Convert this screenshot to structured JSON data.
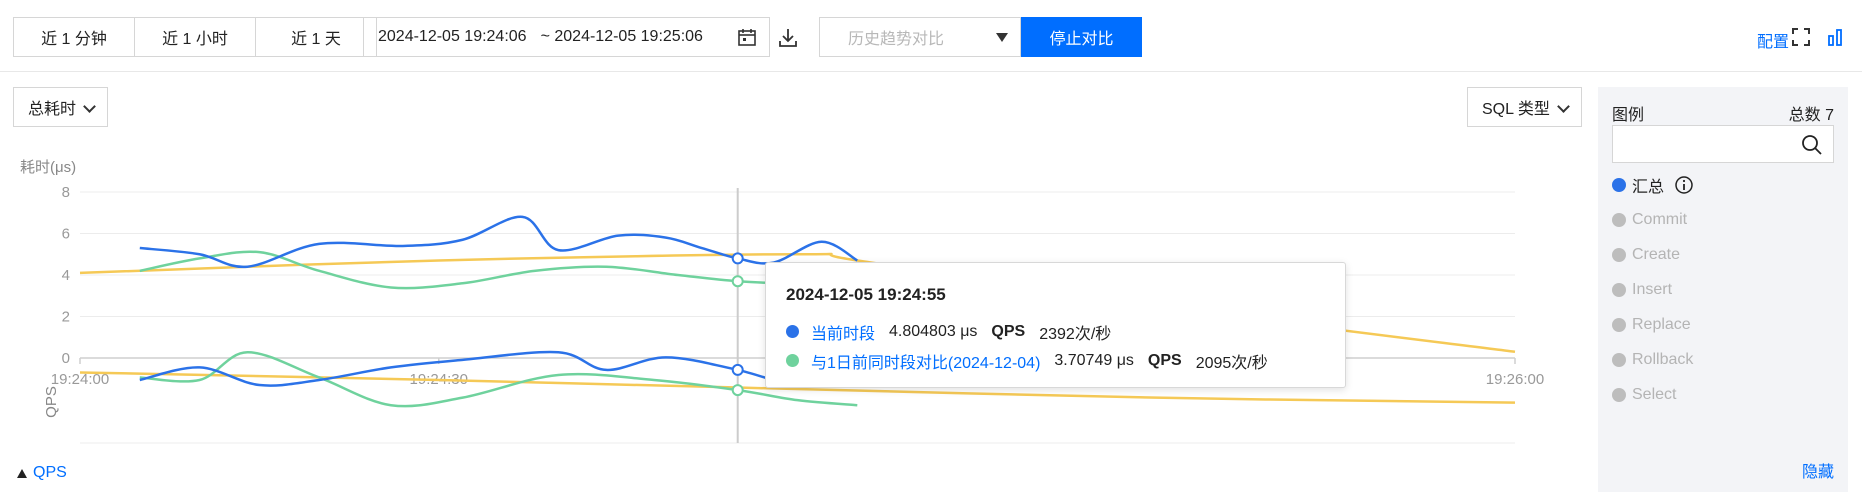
{
  "toolbar": {
    "ranges": [
      "近 1 分钟",
      "近 1 小时",
      "近 1 天"
    ],
    "date_start": "2024-12-05 19:24:06",
    "date_end": "~ 2024-12-05 19:25:06",
    "history_placeholder": "历史趋势对比",
    "stop_compare": "停止对比",
    "config": "配置"
  },
  "controls": {
    "metric_select": "总耗时",
    "sql_type_select": "SQL 类型",
    "qps_toggle": "QPS"
  },
  "legend": {
    "title": "图例",
    "total": "总数 7",
    "items": [
      {
        "label": "汇总",
        "active": true
      },
      {
        "label": "Commit",
        "active": false
      },
      {
        "label": "Create",
        "active": false
      },
      {
        "label": "Insert",
        "active": false
      },
      {
        "label": "Replace",
        "active": false
      },
      {
        "label": "Rollback",
        "active": false
      },
      {
        "label": "Select",
        "active": false
      }
    ],
    "hide": "隐藏"
  },
  "tooltip": {
    "time": "2024-12-05 19:24:55",
    "rows": [
      {
        "name": "当前时段",
        "value": "4.804803 μs",
        "qps_label": "QPS",
        "qps": "2392次/秒",
        "color": "#2b72e8"
      },
      {
        "name": "与1日前同时段对比(2024-12-04)",
        "value": "3.70749 μs",
        "qps_label": "QPS",
        "qps": "2095次/秒",
        "color": "#6fd29d"
      }
    ]
  },
  "colors": {
    "current": "#2b72e8",
    "compare": "#6fd29d",
    "trend": "#f5c956",
    "accent": "#006eff"
  },
  "chart_data": {
    "type": "line",
    "ylabel": "耗时(μs)",
    "ylabel2": "QPS",
    "yticks": [
      "8",
      "6",
      "4",
      "2",
      "0"
    ],
    "ylim": [
      0,
      8
    ],
    "xlim": [
      "19:24:00",
      "19:26:00"
    ],
    "xticks": [
      "19:24:00",
      "19:24:30",
      "19:26:00"
    ],
    "grid": true,
    "series": [
      {
        "name": "当前时段",
        "x": [
          "19:24:05",
          "19:24:10",
          "19:24:14",
          "19:24:20",
          "19:24:27",
          "19:24:32",
          "19:24:37",
          "19:24:40",
          "19:24:45",
          "19:24:49",
          "19:24:52",
          "19:24:55",
          "19:24:58",
          "19:25:02",
          "19:25:05"
        ],
        "values": [
          5.3,
          5.0,
          4.4,
          5.5,
          5.4,
          5.7,
          6.8,
          5.2,
          5.9,
          5.8,
          5.3,
          4.8,
          4.6,
          5.6,
          4.7
        ]
      },
      {
        "name": "与1日前同时段对比(2024-12-04)",
        "x": [
          "19:24:05",
          "19:24:10",
          "19:24:15",
          "19:24:20",
          "19:24:26",
          "19:24:32",
          "19:24:38",
          "19:24:44",
          "19:24:50",
          "19:24:55",
          "19:25:00",
          "19:25:05"
        ],
        "values": [
          4.2,
          4.8,
          5.1,
          4.2,
          3.4,
          3.6,
          4.2,
          4.4,
          4.0,
          3.7,
          3.6,
          3.7
        ]
      },
      {
        "x": [
          "19:24:00",
          "19:24:30",
          "19:25:00",
          "19:25:05",
          "19:25:30",
          "19:26:00"
        ],
        "values": [
          4.1,
          4.7,
          5.0,
          4.7,
          2.5,
          0.3
        ]
      }
    ],
    "qps_series": [
      {
        "x": [
          "19:24:05",
          "19:24:10",
          "19:24:15",
          "19:24:20",
          "19:24:26",
          "19:24:32",
          "19:24:40",
          "19:24:44",
          "19:24:49",
          "19:24:55",
          "19:25:00",
          "19:25:05"
        ],
        "values": [
          0.5,
          0.6,
          0.46,
          0.5,
          0.6,
          0.66,
          0.72,
          0.58,
          0.68,
          0.58,
          0.46,
          0.52
        ]
      },
      {
        "x": [
          "19:24:05",
          "19:24:10",
          "19:24:14",
          "19:24:20",
          "19:24:26",
          "19:24:32",
          "19:24:40",
          "19:24:48",
          "19:24:55",
          "19:25:00",
          "19:25:05"
        ],
        "values": [
          0.52,
          0.5,
          0.72,
          0.52,
          0.3,
          0.36,
          0.54,
          0.5,
          0.42,
          0.34,
          0.3
        ]
      },
      {
        "x": [
          "19:24:00",
          "19:24:30",
          "19:24:55",
          "19:25:30",
          "19:26:00"
        ],
        "values": [
          0.56,
          0.5,
          0.44,
          0.36,
          0.32
        ]
      }
    ],
    "hover_x": "19:24:55"
  }
}
